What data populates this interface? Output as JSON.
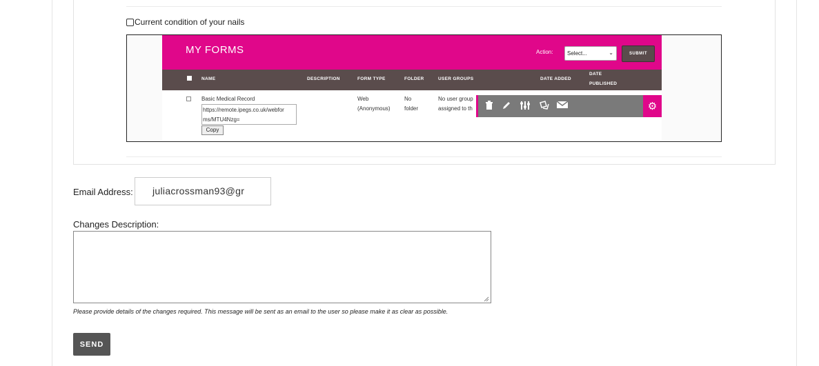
{
  "form": {
    "nails_checkbox_label": "Current condition of your nails",
    "email_label": "Email Address:",
    "email_value": "juliacrossman93@gr",
    "changes_label": "Changes Description:",
    "changes_value": "",
    "hint": "Please provide details of the changes required. This message will be sent as an email to the user so please make it as clear as possible.",
    "send_label": "SEND"
  },
  "embedded": {
    "title": "MY FORMS",
    "action_label": "Action:",
    "select_value": "Select...",
    "submit_label": "SUBMIT",
    "columns": {
      "name": "NAME",
      "description": "DESCRIPTION",
      "form_type": "FORM TYPE",
      "folder": "FOLDER",
      "user_groups": "USER GROUPS",
      "date_added": "DATE ADDED",
      "date_published_1": "DATE",
      "date_published_2": "PUBLISHED"
    },
    "row": {
      "name": "Basic Medical Record",
      "url_1": "https://remote.ipegs.co.uk/webfor",
      "url_2": "ms/MTU4Nzg=",
      "copy_label": "Copy",
      "type_1": "Web",
      "type_2": "(Anonymous)",
      "folder_1": "No",
      "folder_2": "folder",
      "groups_1": "No user group",
      "groups_2": "assigned to th"
    }
  },
  "colors": {
    "brand_pink": "#e0078a",
    "header_brown": "#5a4c4c",
    "send_button": "#555555"
  }
}
